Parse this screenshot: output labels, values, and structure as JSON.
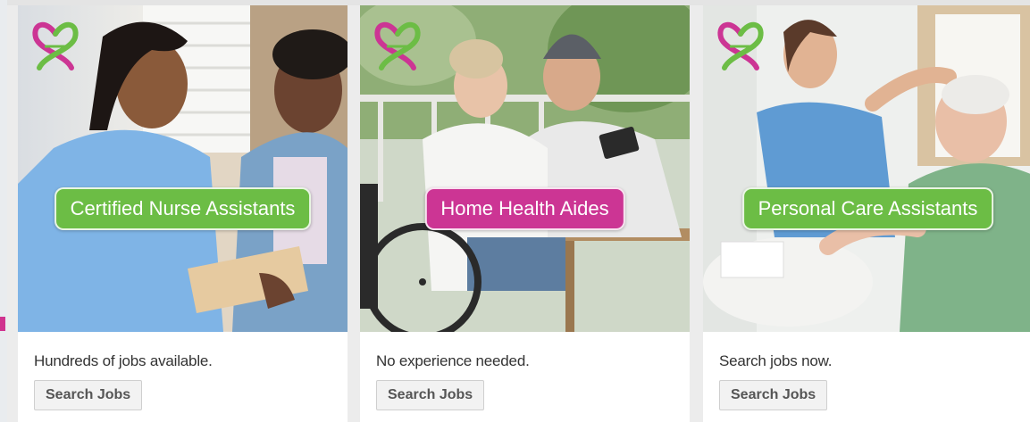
{
  "cards": [
    {
      "badge": "Certified Nurse Assistants",
      "badge_color": "#6cbd45",
      "description": "Hundreds of jobs available.",
      "button": "Search Jobs"
    },
    {
      "badge": "Home Health Aides",
      "badge_color": "#cc3594",
      "description": "No experience needed.",
      "button": "Search Jobs"
    },
    {
      "badge": "Personal Care Assistants",
      "badge_color": "#6cbd45",
      "description": "Search jobs now.",
      "button": "Search Jobs"
    }
  ],
  "logo_icon": "dna-heart-logo-icon",
  "brand_colors": {
    "green": "#6cbd45",
    "magenta": "#cc3594"
  }
}
